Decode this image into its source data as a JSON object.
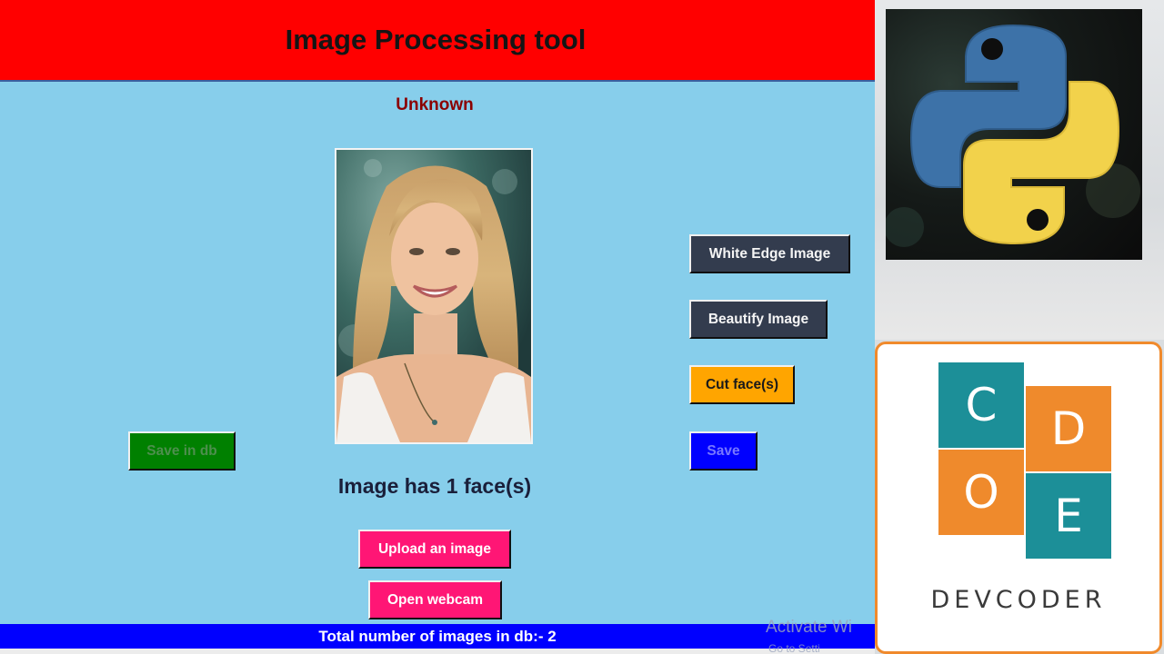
{
  "app": {
    "title": "Image Processing tool",
    "recognized_name": "Unknown",
    "face_count_text": "Image has 1 face(s)",
    "status_text": "Total number of images in db:- 2",
    "buttons": {
      "save_in_db": "Save in db",
      "white_edge": "White Edge Image",
      "beautify": "Beautify Image",
      "cut_faces": "Cut face(s)",
      "save": "Save",
      "upload": "Upload an image",
      "webcam": "Open webcam"
    },
    "colors": {
      "background": "#87ceeb",
      "title_bar": "#ff0000",
      "status_bar": "#0000ff",
      "upload_buttons": "#ff1675",
      "cut_button": "#ffa500",
      "save_db_button": "#008000"
    }
  },
  "watermark": {
    "line1": "Activate Wi",
    "line2": "Go to Setti"
  },
  "logos": {
    "python": "python-logo",
    "devcoder": {
      "letters": [
        "C",
        "D",
        "O",
        "E"
      ],
      "wordmark": "DEVCODER"
    }
  }
}
